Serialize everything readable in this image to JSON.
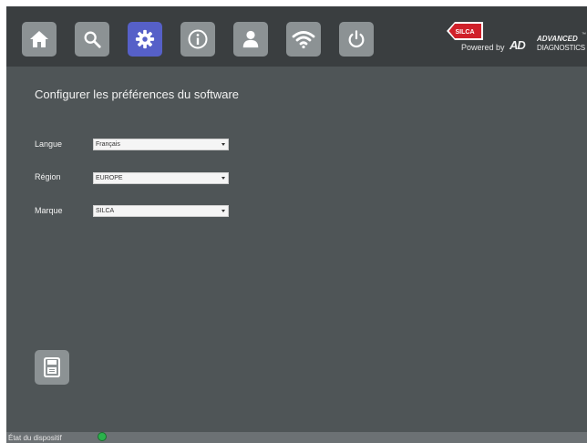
{
  "nav": {
    "items": [
      {
        "icon": "home-icon",
        "active": false
      },
      {
        "icon": "search-icon",
        "active": false
      },
      {
        "icon": "gear-icon",
        "active": true
      },
      {
        "icon": "info-icon",
        "active": false
      },
      {
        "icon": "user-icon",
        "active": false
      },
      {
        "icon": "wifi-icon",
        "active": false
      },
      {
        "icon": "power-icon",
        "active": false
      }
    ],
    "active_color": "#5660c8",
    "button_color": "#8c9294"
  },
  "brand": {
    "silca_label": "SILCA",
    "powered_by": "Powered by",
    "ad_mark": "AD",
    "advanced": "ADVANCED",
    "diagnostics": "DIAGNOSTICS",
    "tm": "™",
    "silca_color": "#d0202a"
  },
  "page": {
    "title": "Configurer les préférences du software"
  },
  "form": {
    "langue": {
      "label": "Langue",
      "value": "Français"
    },
    "region": {
      "label": "Région",
      "value": "EUROPE"
    },
    "marque": {
      "label": "Marque",
      "value": "SILCA"
    }
  },
  "save": {
    "icon": "save-icon"
  },
  "status": {
    "label": "État du dispositif",
    "indicator_color": "#2bb24c"
  }
}
